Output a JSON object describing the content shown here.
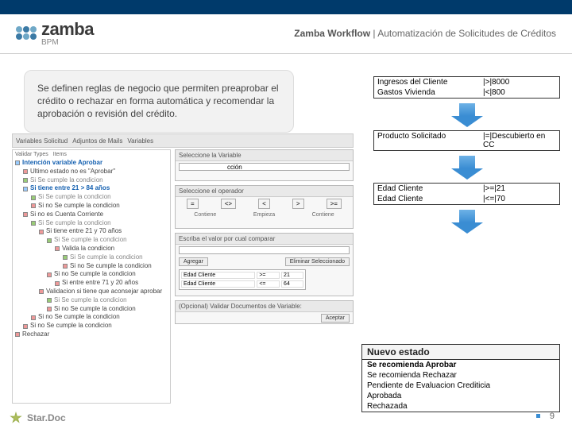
{
  "header": {
    "logo_main": "zamba",
    "logo_sub": "BPM",
    "crumb_strong": "Zamba Workflow",
    "crumb_sep": "  |  ",
    "crumb_tail": "Automatización de Solicitudes de Créditos"
  },
  "callout": {
    "text": "Se definen reglas de negocio que permiten preaprobar el crédito o rechazar en forma automática y recomendar la aprobación o revisión del crédito."
  },
  "toolbar": {
    "items": [
      "Variables Solicitud",
      "Adjuntos de Mails",
      "Variables"
    ]
  },
  "tree": {
    "tabs": [
      "Validar Types",
      "Items"
    ],
    "nodes": [
      {
        "indent": 0,
        "cls": "blue",
        "text": "Intención variable Aprobar"
      },
      {
        "indent": 1,
        "cls": "",
        "text": "Ultimo estado no es \"Aprobar\""
      },
      {
        "indent": 1,
        "cls": "light",
        "text": "Si Se cumple la condicion"
      },
      {
        "indent": 1,
        "cls": "blue",
        "text": "Si tiene entre 21 > 84 años"
      },
      {
        "indent": 2,
        "cls": "light",
        "text": "Si Se cumple la condicion"
      },
      {
        "indent": 2,
        "cls": "",
        "text": "Si no Se cumple la condicion"
      },
      {
        "indent": 1,
        "cls": "",
        "text": "Si no es Cuenta Corriente"
      },
      {
        "indent": 2,
        "cls": "light",
        "text": "Si Se cumple la condicion"
      },
      {
        "indent": 3,
        "cls": "",
        "text": "Si tiene entre 21 y 70 años"
      },
      {
        "indent": 4,
        "cls": "light",
        "text": "Si Se cumple la condicion"
      },
      {
        "indent": 5,
        "cls": "",
        "text": "Valida la condicion"
      },
      {
        "indent": 6,
        "cls": "light",
        "text": "Si Se cumple la condicion"
      },
      {
        "indent": 6,
        "cls": "",
        "text": "Si no Se cumple la condicion"
      },
      {
        "indent": 4,
        "cls": "",
        "text": "Si no Se cumple la condicion"
      },
      {
        "indent": 5,
        "cls": "",
        "text": "Si entre entre 71 y 20 años"
      },
      {
        "indent": 3,
        "cls": "",
        "text": "Validacion si tiene que aconsejar aprobar"
      },
      {
        "indent": 4,
        "cls": "light",
        "text": "Si Se cumple la condicion"
      },
      {
        "indent": 4,
        "cls": "",
        "text": "Si no Se cumple la condicion"
      },
      {
        "indent": 2,
        "cls": "",
        "text": "Si no Se cumple la condicion"
      },
      {
        "indent": 1,
        "cls": "",
        "text": "Si no Se cumple la condicion"
      },
      {
        "indent": 0,
        "cls": "",
        "text": "Rechazar"
      }
    ]
  },
  "config": {
    "box1": {
      "title": "Seleccione la Variable",
      "value": "cción"
    },
    "box2": {
      "title": "Seleccione el operador",
      "ops": [
        "=",
        "<>",
        "<",
        ">",
        ">="
      ],
      "ops2": [
        "Contiene",
        "Empieza",
        "Contiene"
      ]
    },
    "box3": {
      "title": "Escriba el valor por cual comparar",
      "btn_add": "Agregar",
      "btn_del": "Eliminar Seleccionado",
      "table": [
        [
          "Edad Cliente",
          ">=",
          "21"
        ],
        [
          "Edad Cliente",
          "<=",
          "64"
        ]
      ]
    },
    "box4": {
      "title": "(Opcional) Validar Documentos de Variable:",
      "btn": "Aceptar"
    }
  },
  "rules": [
    {
      "rows": [
        {
          "l": "Ingresos del Cliente",
          "r": "|>|8000"
        },
        {
          "l": "Gastos Vivienda",
          "r": "|<|800"
        }
      ]
    },
    {
      "rows": [
        {
          "l": "Producto Solicitado",
          "r": "|=|Descubierto en CC"
        }
      ]
    },
    {
      "rows": [
        {
          "l": "Edad Cliente",
          "r": "|>=|21"
        },
        {
          "l": "Edad Cliente",
          "r": "|<=|70"
        }
      ]
    }
  ],
  "state": {
    "title": "Nuevo estado",
    "options": [
      {
        "text": "Se recomienda Aprobar",
        "bold": true
      },
      {
        "text": "Se recomienda Rechazar",
        "bold": false
      },
      {
        "text": "Pendiente de Evaluacion Crediticia",
        "bold": false
      },
      {
        "text": "Aprobada",
        "bold": false
      },
      {
        "text": "Rechazada",
        "bold": false
      }
    ]
  },
  "footer": {
    "brand": "Star.Doc",
    "page": "9"
  }
}
